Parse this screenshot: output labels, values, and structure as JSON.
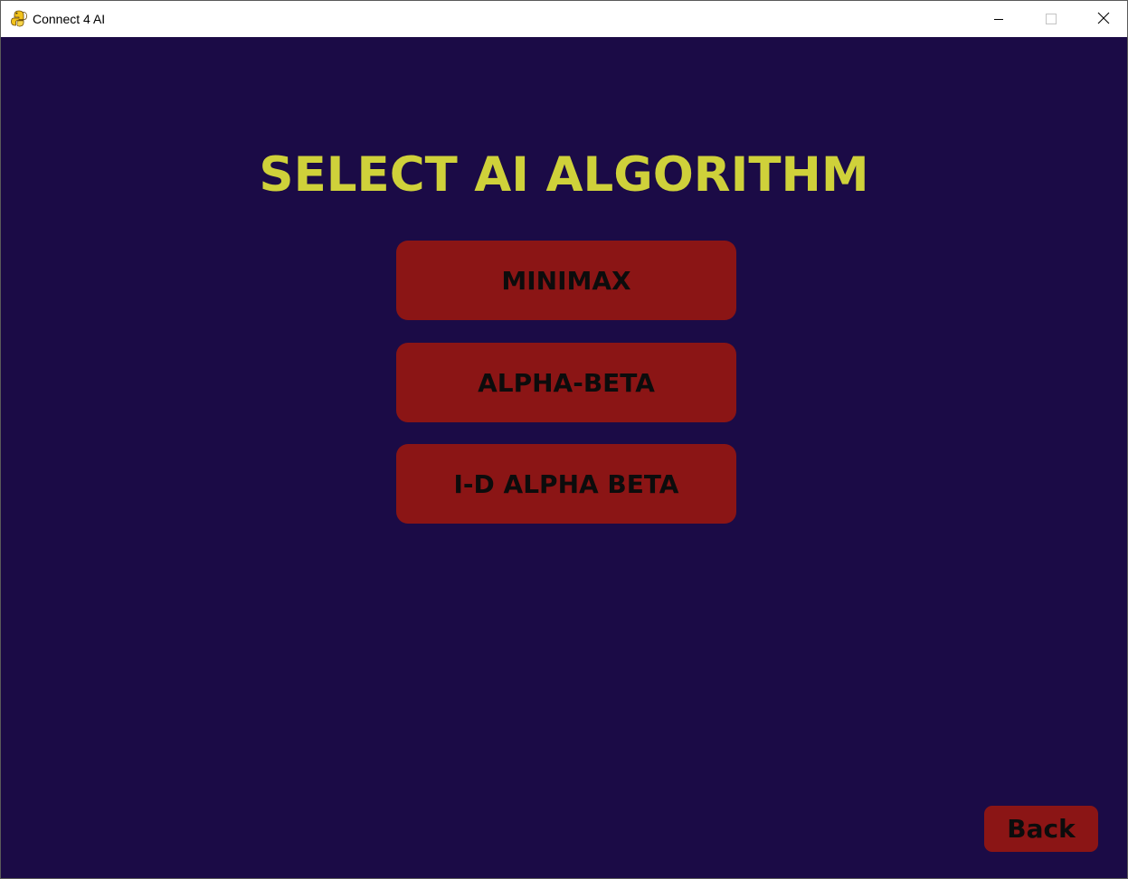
{
  "window": {
    "title": "Connect 4 AI",
    "app_icon": "pygame-snake-icon",
    "controls": {
      "minimize_icon": "minimize-icon",
      "maximize_icon": "maximize-icon",
      "close_icon": "close-icon"
    }
  },
  "screen": {
    "heading": "SELECT AI ALGORITHM",
    "options": [
      {
        "label": "MINIMAX"
      },
      {
        "label": "ALPHA-BETA"
      },
      {
        "label": "I-D ALPHA BETA"
      }
    ],
    "back_label": "Back"
  },
  "colors": {
    "background": "#1b0b46",
    "heading": "#cfd13a",
    "button": "#8b1515",
    "button_text": "#0c0c0c"
  }
}
